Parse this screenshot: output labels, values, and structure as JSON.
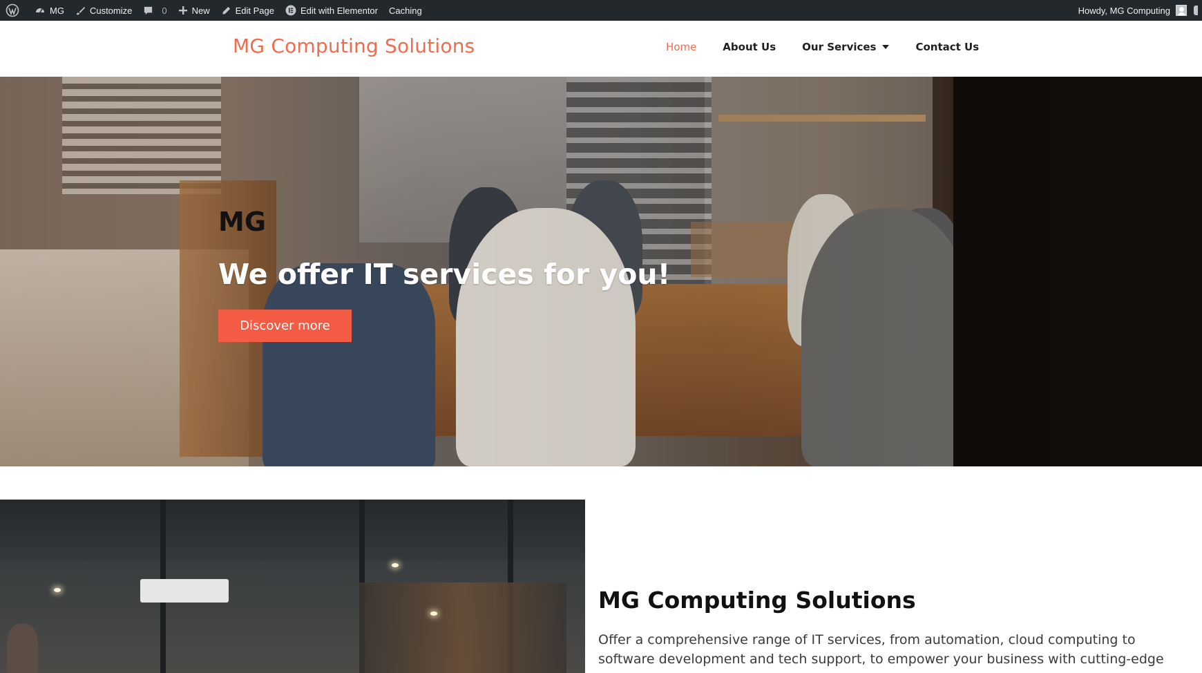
{
  "admin_bar": {
    "site_name": "MG",
    "customize": "Customize",
    "comments_count": "0",
    "new_label": "New",
    "edit_page": "Edit Page",
    "edit_with_elementor": "Edit with Elementor",
    "caching": "Caching",
    "greeting": "Howdy, MG Computing"
  },
  "header": {
    "brand": "MG Computing Solutions",
    "nav": [
      {
        "label": "Home",
        "active": true
      },
      {
        "label": "About Us"
      },
      {
        "label": "Our Services",
        "has_dropdown": true
      },
      {
        "label": "Contact Us"
      }
    ]
  },
  "hero": {
    "eyebrow": "MG",
    "title": "We offer IT services for you!",
    "cta_label": "Discover more"
  },
  "about": {
    "title": "MG Computing Solutions",
    "text": "Offer a comprehensive range of IT services, from automation, cloud computing to software development and tech support, to empower your business with cutting-edge"
  },
  "colors": {
    "accent": "#f26b4e",
    "button": "#f45b44",
    "admin_bar": "#23282d"
  }
}
